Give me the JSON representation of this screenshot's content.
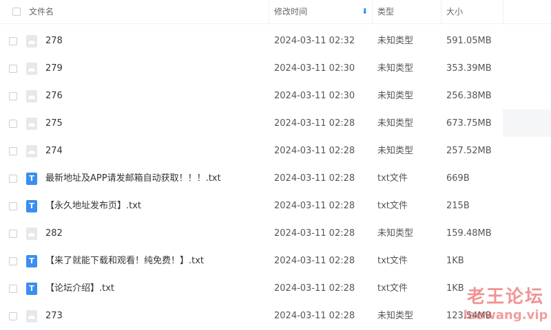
{
  "header": {
    "col_name": "文件名",
    "col_modified": "修改时间",
    "col_type": "类型",
    "col_size": "大小",
    "sort_icon": "arrow-down-icon"
  },
  "files": [
    {
      "name": "278",
      "date": "2024-03-11 02:32",
      "type": "未知类型",
      "size": "591.05MB",
      "icon": "unknown-file-icon"
    },
    {
      "name": "279",
      "date": "2024-03-11 02:30",
      "type": "未知类型",
      "size": "353.39MB",
      "icon": "unknown-file-icon"
    },
    {
      "name": "276",
      "date": "2024-03-11 02:30",
      "type": "未知类型",
      "size": "256.38MB",
      "icon": "unknown-file-icon"
    },
    {
      "name": "275",
      "date": "2024-03-11 02:28",
      "type": "未知类型",
      "size": "673.75MB",
      "icon": "unknown-file-icon"
    },
    {
      "name": "274",
      "date": "2024-03-11 02:28",
      "type": "未知类型",
      "size": "257.52MB",
      "icon": "unknown-file-icon"
    },
    {
      "name": "最新地址及APP请发邮箱自动获取！！！.txt",
      "date": "2024-03-11 02:28",
      "type": "txt文件",
      "size": "669B",
      "icon": "txt-file-icon",
      "icon_glyph": "T"
    },
    {
      "name": "【永久地址发布页】.txt",
      "date": "2024-03-11 02:28",
      "type": "txt文件",
      "size": "215B",
      "icon": "txt-file-icon",
      "icon_glyph": "T"
    },
    {
      "name": "282",
      "date": "2024-03-11 02:28",
      "type": "未知类型",
      "size": "159.48MB",
      "icon": "unknown-file-icon"
    },
    {
      "name": "【来了就能下载和观看！纯免费！】.txt",
      "date": "2024-03-11 02:28",
      "type": "txt文件",
      "size": "1KB",
      "icon": "txt-file-icon",
      "icon_glyph": "T"
    },
    {
      "name": "【论坛介绍】.txt",
      "date": "2024-03-11 02:28",
      "type": "txt文件",
      "size": "1KB",
      "icon": "txt-file-icon",
      "icon_glyph": "T"
    },
    {
      "name": "273",
      "date": "2024-03-11 02:28",
      "type": "未知类型",
      "size": "123.54MB",
      "icon": "unknown-file-icon"
    }
  ],
  "watermark": {
    "title": "老王论坛",
    "url": "laowang.vip"
  }
}
